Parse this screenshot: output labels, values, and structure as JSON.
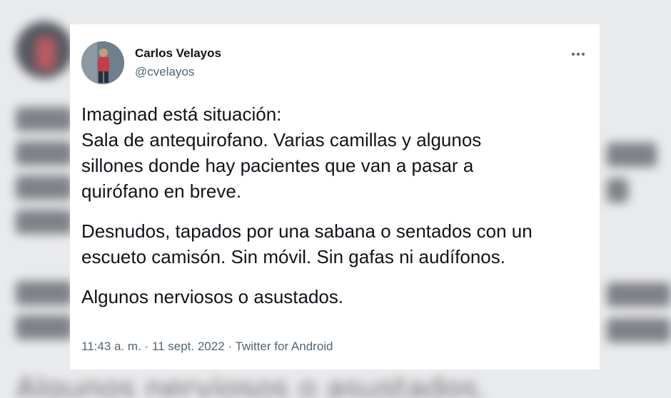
{
  "tweet": {
    "author": {
      "name": "Carlos Velayos",
      "handle": "@cvelayos"
    },
    "paragraphs": [
      {
        "lines": [
          "Imaginad está situación:",
          "Sala de antequirofano. Varias camillas y algunos",
          "sillones donde hay pacientes que van a pasar a",
          "quirófano en breve."
        ]
      },
      {
        "lines": [
          "Desnudos, tapados por una sabana o sentados con un",
          "escueto camisón. Sin móvil. Sin gafas ni audífonos."
        ]
      },
      {
        "lines": [
          "Algunos nerviosos o asustados."
        ]
      }
    ],
    "meta": {
      "time": "11:43 a. m.",
      "date": "11 sept. 2022",
      "source": "Twitter for Android",
      "separator": " · "
    },
    "more_icon": "more-horizontal-icon"
  },
  "background": {
    "blurred_caption": "Algunos nerviosos o asustados."
  },
  "colors": {
    "primary_text": "#0f1419",
    "secondary_text": "#536471",
    "card_bg": "#ffffff",
    "page_bg": "#e9eaec"
  }
}
